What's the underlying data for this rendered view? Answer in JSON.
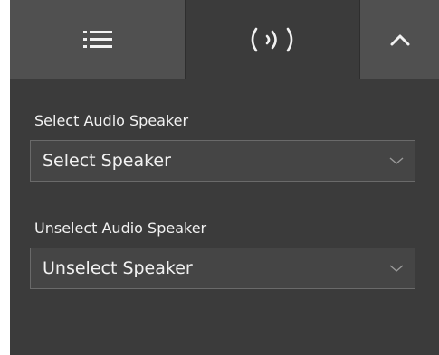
{
  "tabs": [
    {
      "icon": "list-icon",
      "active": false
    },
    {
      "icon": "audio-wave-icon",
      "active": true
    },
    {
      "icon": "chevron-up-icon",
      "active": false
    }
  ],
  "select_speaker": {
    "label": "Select Audio Speaker",
    "value": "Select Speaker"
  },
  "unselect_speaker": {
    "label": "Unselect Audio Speaker",
    "value": "Unselect Speaker"
  },
  "colors": {
    "panel_bg": "#3b3b3b",
    "tab_bg": "#505050",
    "dropdown_bg": "#454545",
    "dropdown_border": "#6a6a6a",
    "text": "#f2f2f2"
  }
}
